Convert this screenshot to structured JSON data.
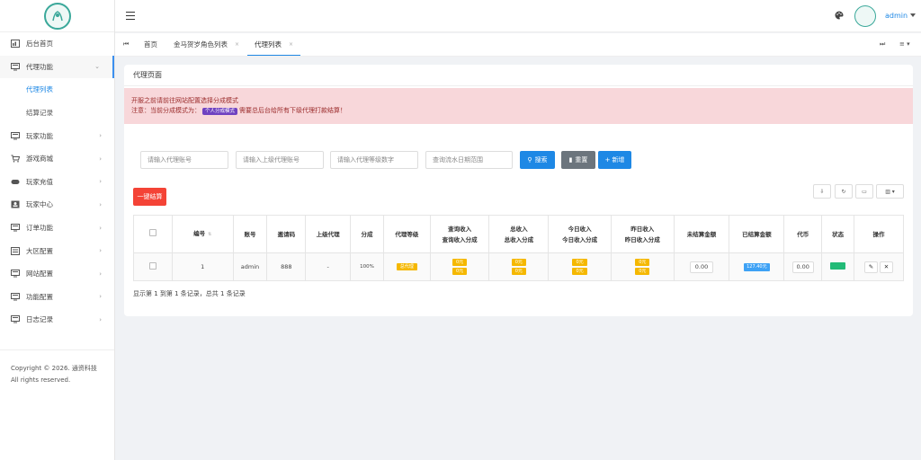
{
  "sidebar": {
    "items": [
      {
        "label": "后台首页",
        "icon": "dashboard-icon"
      },
      {
        "label": "代理功能",
        "icon": "monitor-icon",
        "open": true,
        "sub": [
          {
            "label": "代理列表",
            "active": true
          },
          {
            "label": "结算记录"
          }
        ]
      },
      {
        "label": "玩家功能",
        "icon": "monitor-icon"
      },
      {
        "label": "游戏商城",
        "icon": "cart-icon"
      },
      {
        "label": "玩家充值",
        "icon": "gamepad-icon"
      },
      {
        "label": "玩家中心",
        "icon": "user-card-icon"
      },
      {
        "label": "订单功能",
        "icon": "monitor-icon"
      },
      {
        "label": "大区配置",
        "icon": "list-icon"
      },
      {
        "label": "网站配置",
        "icon": "monitor-icon"
      },
      {
        "label": "功能配置",
        "icon": "monitor-icon"
      },
      {
        "label": "日志记录",
        "icon": "monitor-icon"
      }
    ],
    "copyright": "Copyright © 2026. 通资科技 All rights reserved."
  },
  "header": {
    "user": "admin"
  },
  "tabs": {
    "items": [
      "首页",
      "金马贺岁角色列表",
      "代理列表"
    ],
    "active": "代理列表"
  },
  "page": {
    "title": "代理页面",
    "alert_line1": "开服之前请前往网站配置选择分成模式",
    "alert_line2_prefix": "注意：当前分成模式为：",
    "alert_badge": "个人分成模式",
    "alert_line2_suffix": "需要总后台给所有下级代理打款结算！"
  },
  "search": {
    "account_placeholder": "请输入代理账号",
    "parent_placeholder": "请输入上级代理账号",
    "level_placeholder": "请输入代理等级数字",
    "date_placeholder": "查询流水日期范围",
    "search_label": "搜索",
    "reset_label": "重置",
    "add_label": "新增",
    "settle_label": "一键结算"
  },
  "table": {
    "headers": {
      "id": "编号",
      "account": "账号",
      "invite": "邀请码",
      "parent": "上级代理",
      "share": "分成",
      "level": "代理等级",
      "query_income": [
        "查询收入",
        "查询收入分成"
      ],
      "total_income": [
        "总收入",
        "总收入分成"
      ],
      "today_income": [
        "今日收入",
        "今日收入分成"
      ],
      "yesterday_income": [
        "昨日收入",
        "昨日收入分成"
      ],
      "unsettled": "未结算金额",
      "settled": "已结算金额",
      "coin": "代币",
      "status": "状态",
      "ops": "操作"
    },
    "rows": [
      {
        "id": "1",
        "account": "admin",
        "invite": "888",
        "parent": "-",
        "share": "100%",
        "level": "总代理",
        "query_income": [
          "0元",
          "0元"
        ],
        "total_income": [
          "0元",
          "0元"
        ],
        "today_income": [
          "0元",
          "0元"
        ],
        "yesterday_income": [
          "0元",
          "0元"
        ],
        "unsettled": "0.00",
        "settled": "127.40元",
        "coin": "0.00"
      }
    ],
    "summary": "显示第 1 到第 1 条记录，总共 1 条记录"
  },
  "colors": {
    "primary": "#1e88e5",
    "danger": "#f44336",
    "warning": "#f5b800",
    "success": "#22bb77",
    "alert_bg": "#f8d7da"
  }
}
